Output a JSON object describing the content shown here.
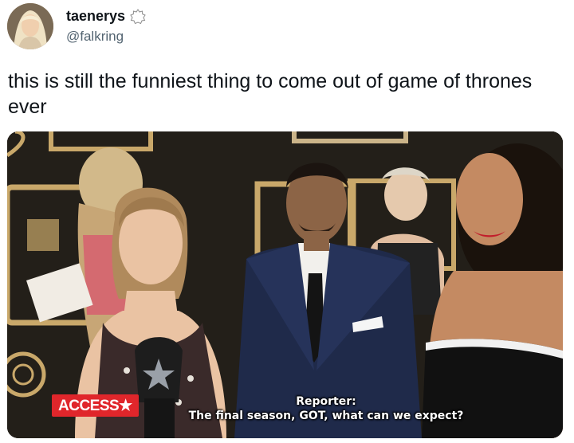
{
  "author": {
    "display_name": "taenerys",
    "handle": "@falkring",
    "badge_icon": "verified-badge-icon"
  },
  "tweet": {
    "text": "this is still the funniest thing to come out of game of thrones ever"
  },
  "media": {
    "overlay_logo": "ACCESS★",
    "caption_speaker": "Reporter:",
    "caption_line": "The final season, GOT, what can we expect?",
    "colors": {
      "backdrop": "#1a1713",
      "logo_red": "#e0262b",
      "suit_navy": "#1f2a4a"
    }
  }
}
